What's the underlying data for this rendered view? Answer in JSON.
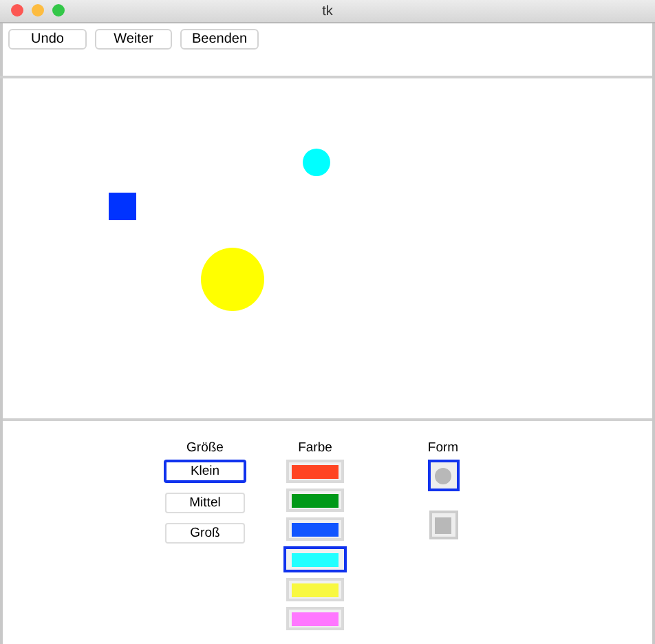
{
  "window": {
    "title": "tk"
  },
  "toolbar": [
    "Undo",
    "Weiter",
    "Beenden"
  ],
  "canvas": {
    "shapes": [
      {
        "kind": "square",
        "color": "#0033ff"
      },
      {
        "kind": "circle",
        "color": "#00ffff"
      },
      {
        "kind": "circle",
        "color": "#ffff00"
      }
    ]
  },
  "size": {
    "label": "Größe",
    "options": [
      {
        "label": "Klein",
        "selected": true
      },
      {
        "label": "Mittel",
        "selected": false
      },
      {
        "label": "Groß",
        "selected": false
      }
    ]
  },
  "color": {
    "label": "Farbe",
    "options": [
      {
        "color": "#ff4422",
        "selected": false
      },
      {
        "color": "#009918",
        "selected": false
      },
      {
        "color": "#1155ff",
        "selected": false
      },
      {
        "color": "#22ffff",
        "selected": true
      },
      {
        "color": "#f8f840",
        "selected": false
      },
      {
        "color": "#ff77ff",
        "selected": false
      }
    ]
  },
  "form": {
    "label": "Form",
    "options": [
      {
        "kind": "circle",
        "selected": true
      },
      {
        "kind": "square",
        "selected": false
      }
    ]
  }
}
